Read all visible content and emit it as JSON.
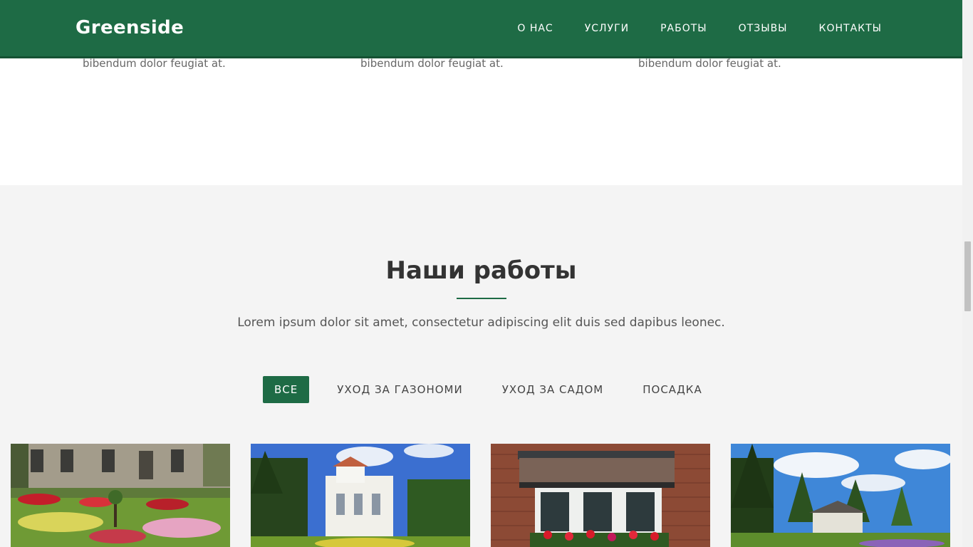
{
  "header": {
    "brand": "Greenside",
    "nav": [
      "О НАС",
      "УСЛУГИ",
      "РАБОТЫ",
      "ОТЗЫВЫ",
      "КОНТАКТЫ"
    ]
  },
  "services_tail": {
    "texts": [
      "bibendum dolor feugiat at.",
      "bibendum dolor feugiat at.",
      "bibendum dolor feugiat at."
    ]
  },
  "portfolio": {
    "title": "Наши работы",
    "description": "Lorem ipsum dolor sit amet, consectetur adipiscing elit duis sed dapibus leonec.",
    "filters": [
      "ВСЕ",
      "УХОД ЗА ГАЗОНОМИ",
      "УХОД ЗА САДОМ",
      "ПОСАДКА"
    ],
    "active_filter": "ВСЕ",
    "items": [
      {
        "subject": "manor-garden-photo"
      },
      {
        "subject": "white-villa-photo"
      },
      {
        "subject": "flower-window-photo"
      },
      {
        "subject": "house-trees-photo"
      }
    ]
  },
  "colors": {
    "brand_green": "#1e6b45",
    "section_bg": "#f4f4f4"
  }
}
